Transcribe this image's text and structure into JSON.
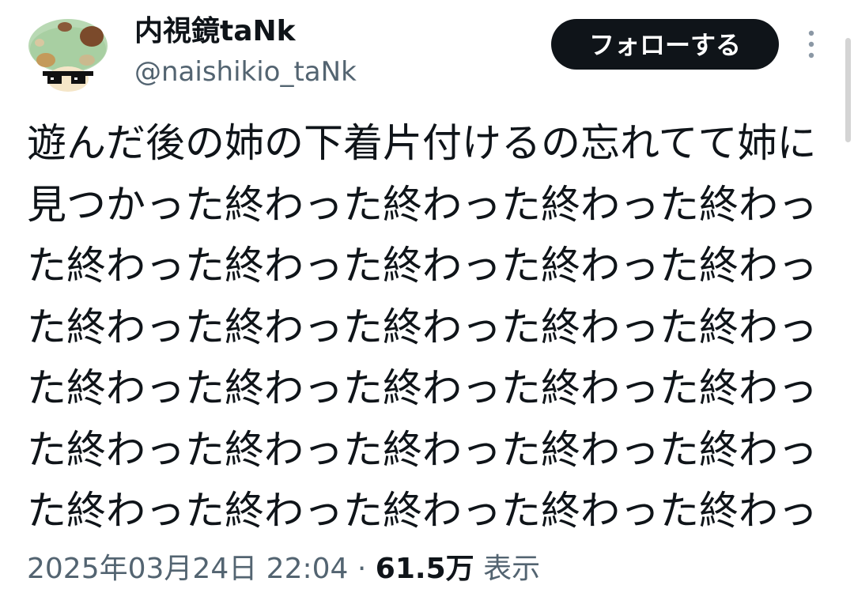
{
  "author": {
    "display_name": "内視鏡taNk",
    "handle": "@naishikio_taNk",
    "avatar_icon": "mushroom-with-sunglasses-avatar"
  },
  "actions": {
    "follow_label": "フォローする",
    "more_icon": "more-vertical-icon"
  },
  "tweet": {
    "lines": [
      "遊んだ後の姉の下着片付けるの忘れてて姉に",
      "見つかった終わった終わった終わった終わっ",
      "た終わった終わった終わった終わった終わっ",
      "た終わった終わった終わった終わった終わっ",
      "た終わった終わった終わった終わった終わっ",
      "た終わった終わった終わった終わった終わっ",
      "た終わった終わった終わった終わった終わっ"
    ],
    "timestamp": "2025年03月24日 22:04",
    "separator": "·",
    "views_count": "61.5万",
    "views_label": "表示"
  },
  "colors": {
    "text": "#0f1419",
    "secondary_text": "#536471",
    "follow_bg": "#0f1419",
    "follow_text": "#ffffff",
    "avatar_cap": "#b9d9b4",
    "avatar_spots": "#7b4a2b"
  }
}
